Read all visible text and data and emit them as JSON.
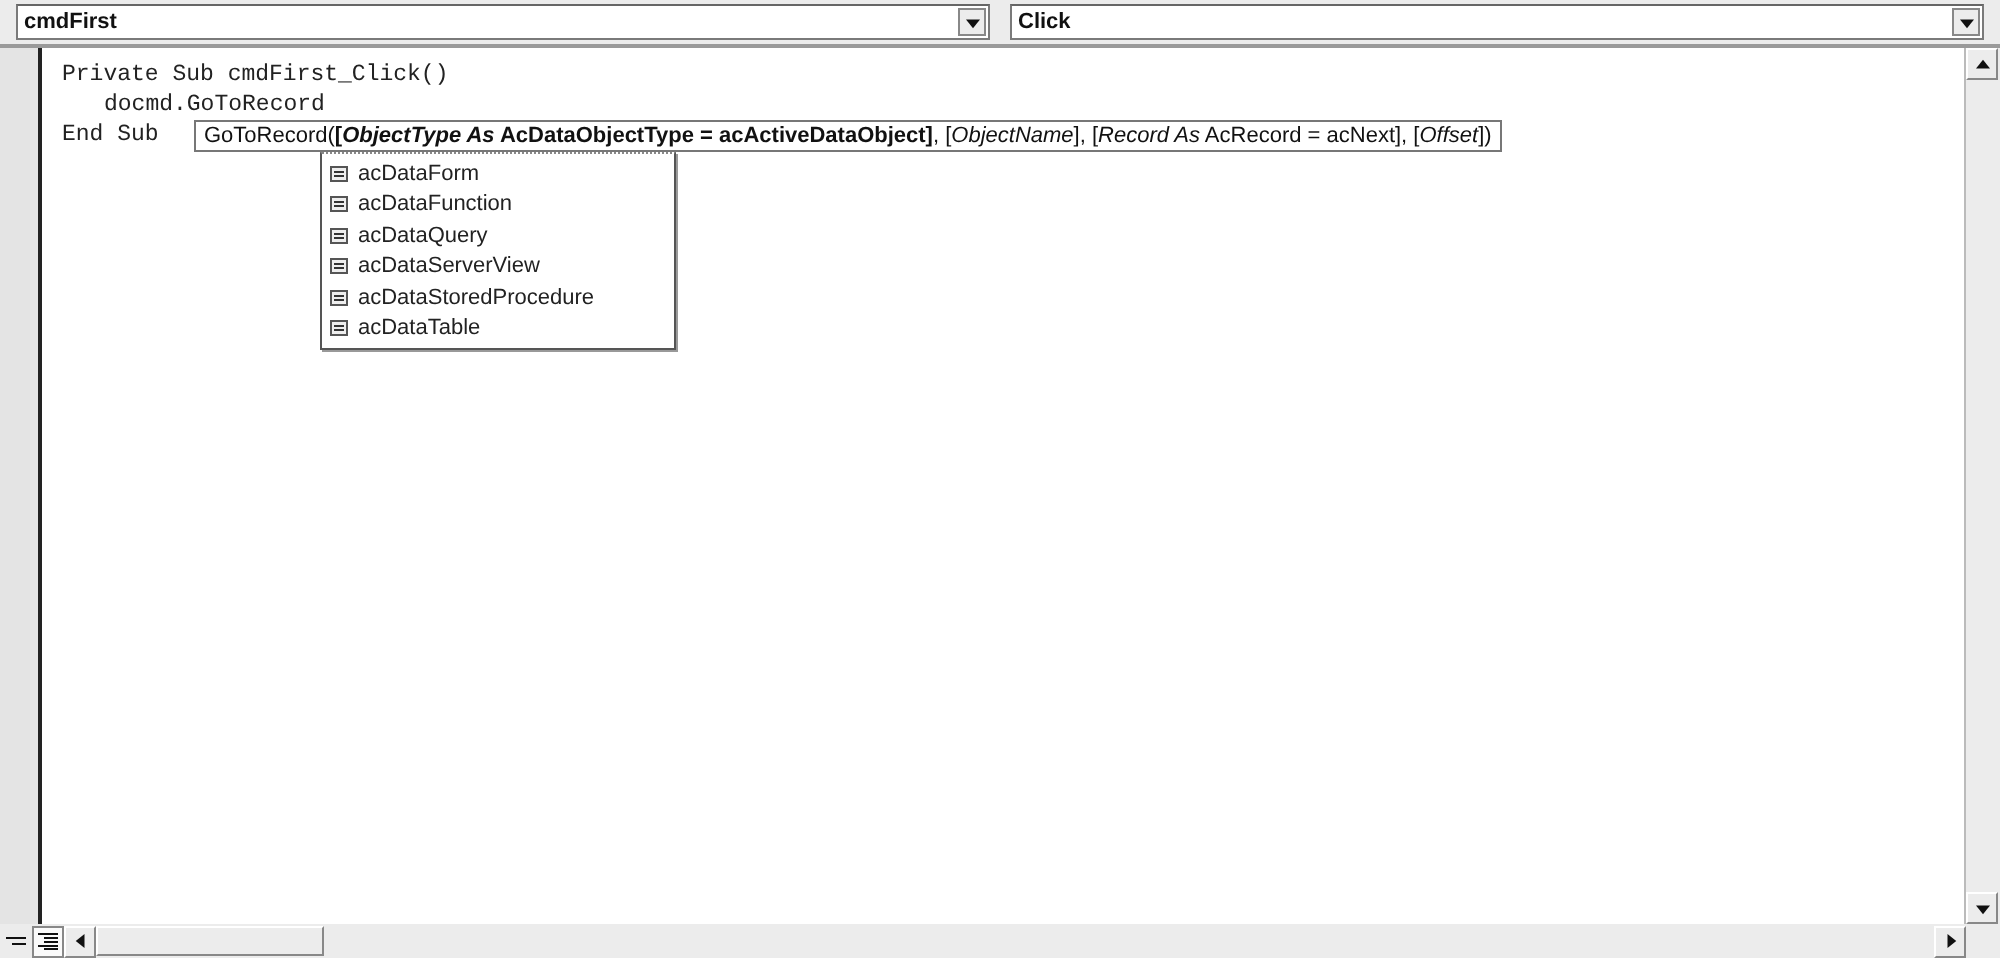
{
  "object_combo": {
    "value": "cmdFirst"
  },
  "procedure_combo": {
    "value": "Click"
  },
  "code_lines": [
    {
      "text": "Private Sub cmdFirst_Click()",
      "indented": false
    },
    {
      "text": "docmd.GoToRecord",
      "indented": true
    },
    {
      "text": "End Sub",
      "indented": false
    }
  ],
  "signature_tip": {
    "text": "GoToRecord(**[*ObjectType As* AcDataObjectType = acActiveDataObject]**, [*ObjectName*], [*Record As* AcRecord = acNext], [*Offset*])"
  },
  "member_list": [
    {
      "label": "acDataForm",
      "selected": false
    },
    {
      "label": "acDataFunction",
      "selected": false
    },
    {
      "label": "acDataQuery",
      "selected": false
    },
    {
      "label": "acDataServerView",
      "selected": false
    },
    {
      "label": "acDataStoredProcedure",
      "selected": false
    },
    {
      "label": "acDataTable",
      "selected": false
    }
  ],
  "view_buttons": [
    {
      "kind": "procedure",
      "selected": false
    },
    {
      "kind": "module",
      "selected": true
    }
  ]
}
